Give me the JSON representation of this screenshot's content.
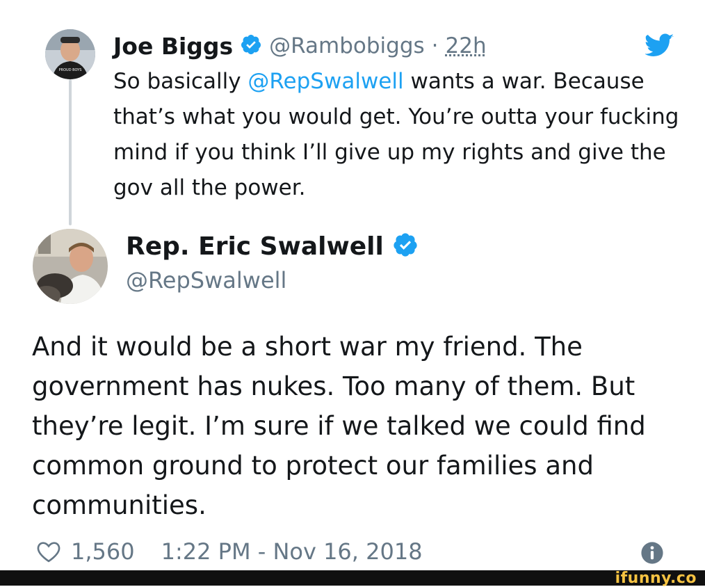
{
  "reply": {
    "author_name": "Joe Biggs",
    "handle": "@Rambobiggs",
    "separator": "·",
    "time_ago": "22h",
    "text_before": "So basically ",
    "mention": "@RepSwalwell",
    "text_after": " wants a war. Because that’s what you would get. You’re outta your fucking mind if you think I’ll give up my rights and give the gov all the power.",
    "avatar_shirt_text": "PROUD BOYS"
  },
  "tweet": {
    "author_name": "Rep. Eric Swalwell",
    "handle": "@RepSwalwell",
    "text": "And it would be a short war my friend. The government has nukes. Too many of them. But they’re legit. I’m sure if we talked we could find common ground to protect our families and communities.",
    "likes": "1,560",
    "timestamp": "1:22 PM - Nov 16, 2018"
  },
  "watermark": "ifunny.co",
  "colors": {
    "twitter_blue": "#1da1f2",
    "text": "#14171a",
    "secondary": "#657786",
    "thread_line": "#cfd5da",
    "footer_bar": "#101010",
    "watermark": "#f6c342"
  },
  "icons": {
    "verified": "verified-badge-icon",
    "twitter": "twitter-bird-icon",
    "like": "heart-outline-icon",
    "info": "info-icon"
  }
}
